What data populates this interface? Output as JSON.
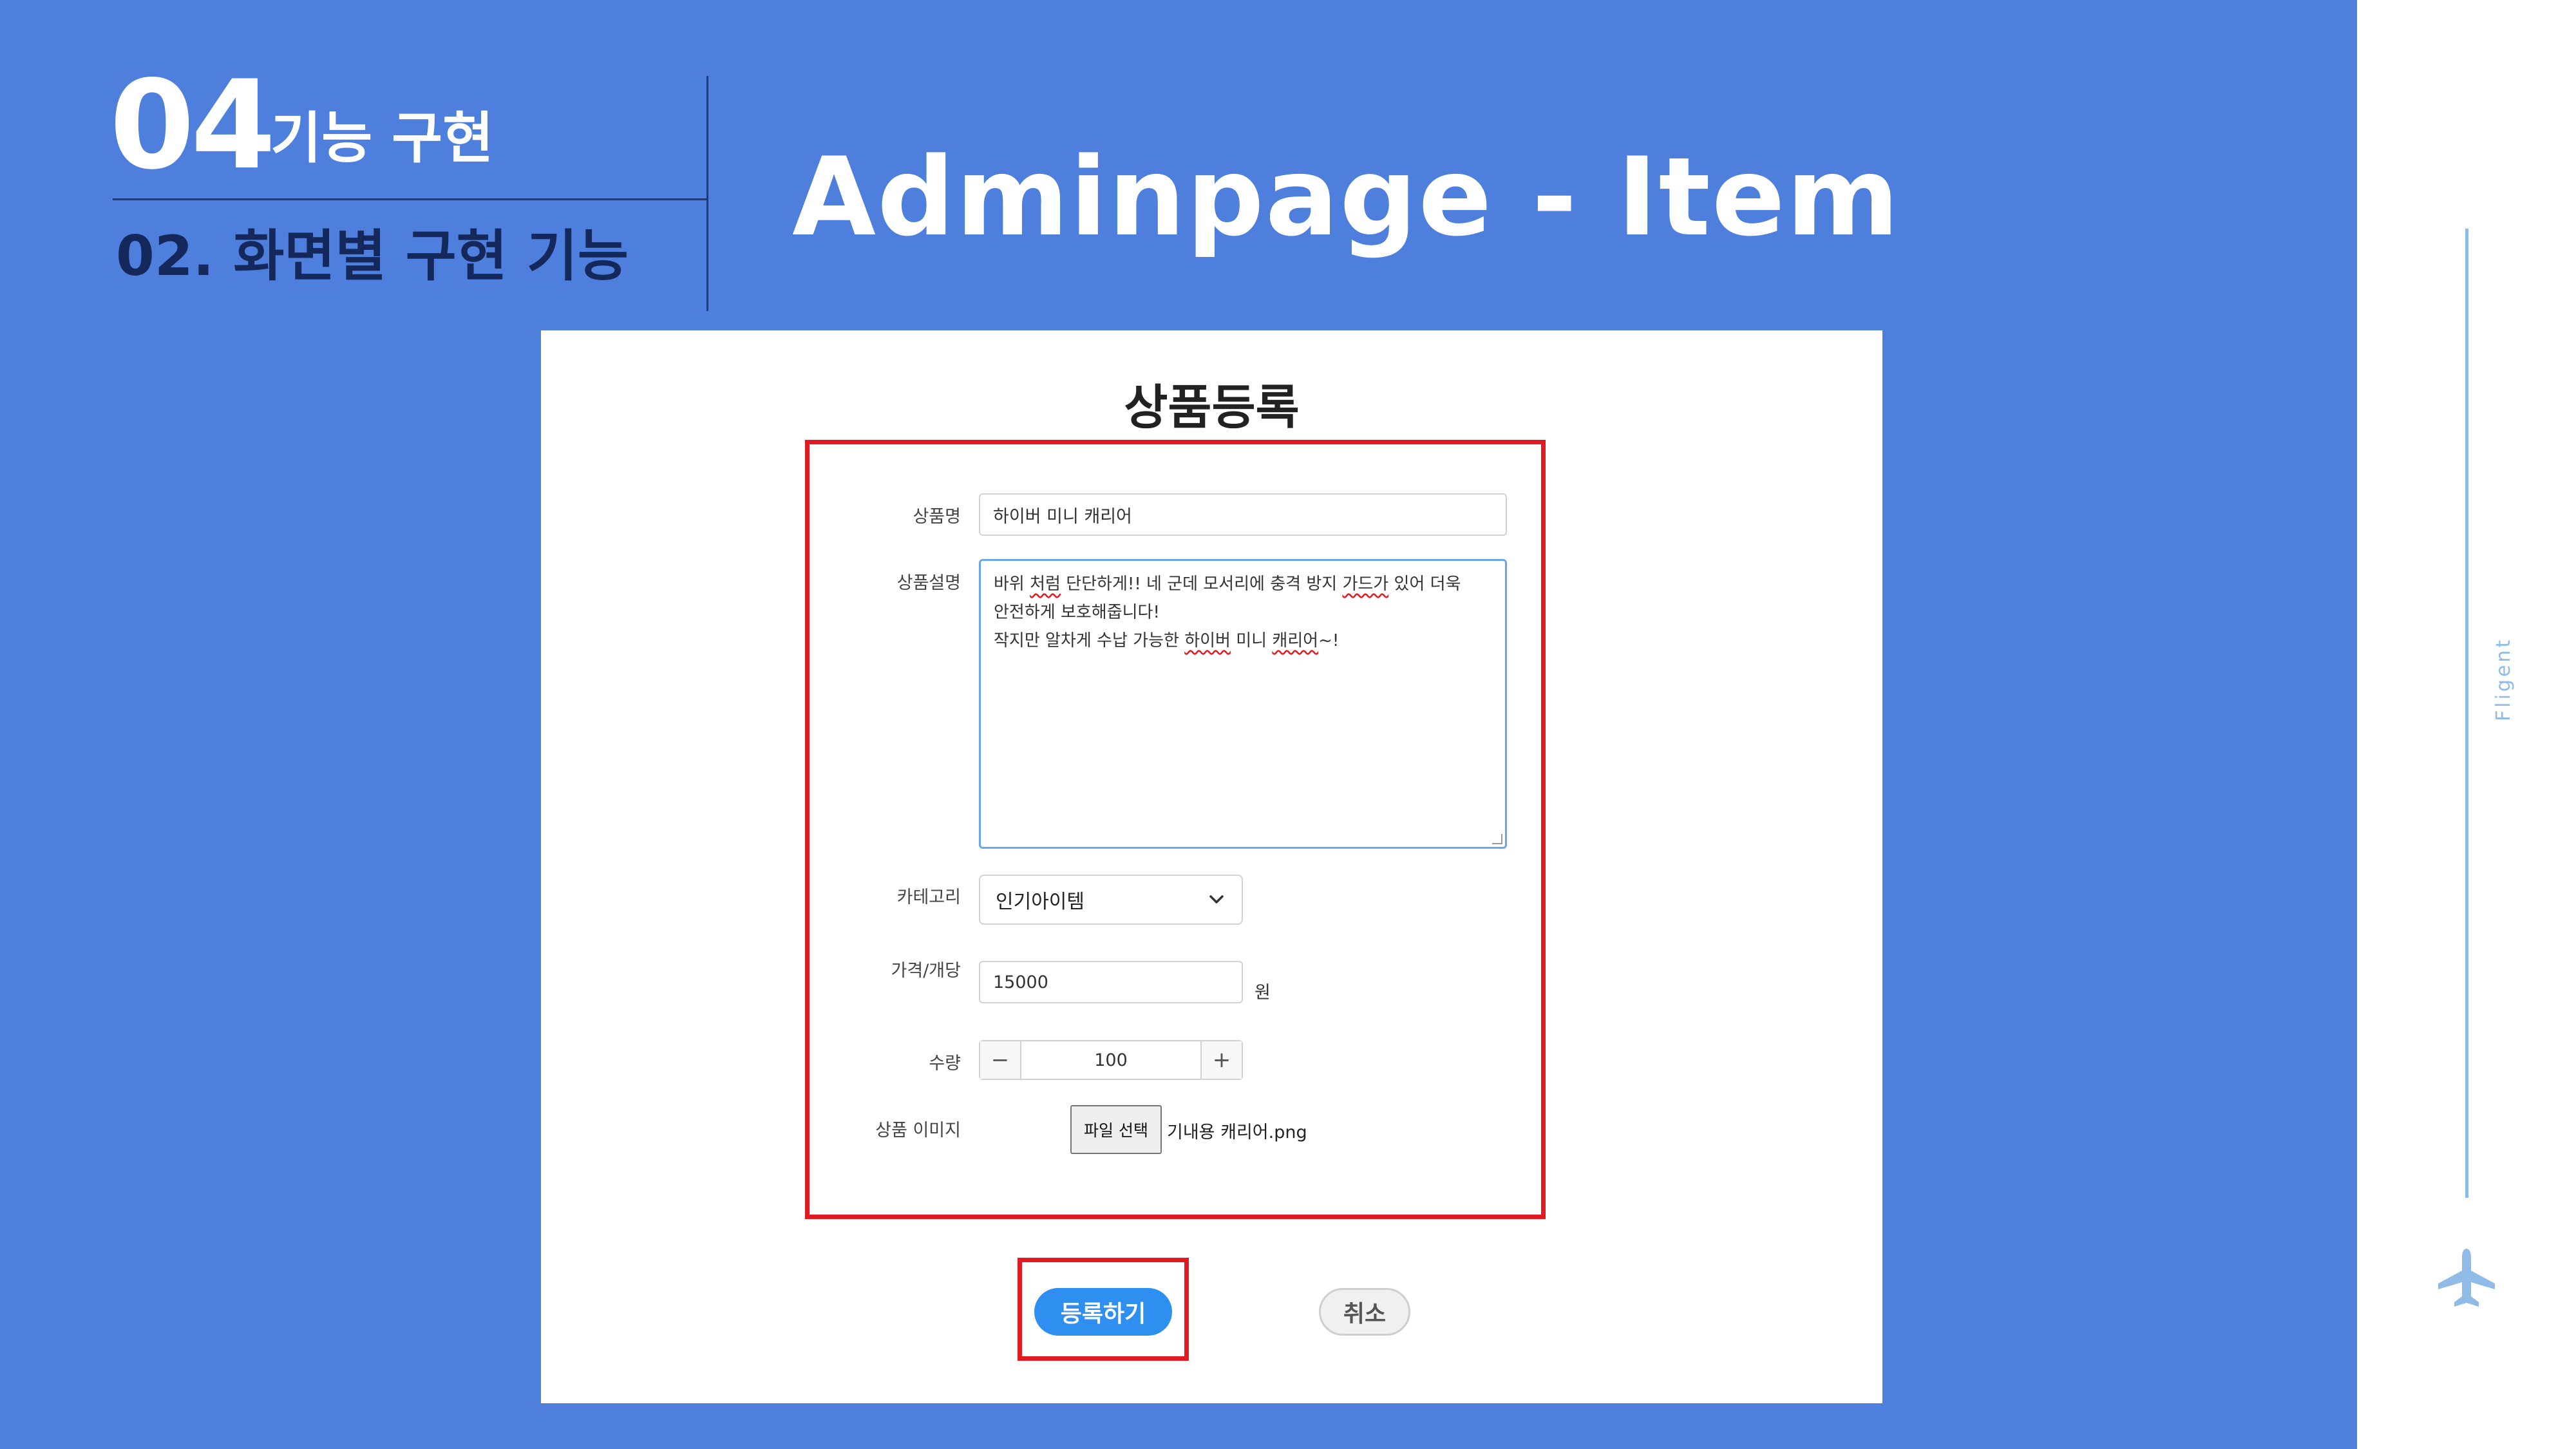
{
  "slide": {
    "section_number": "04",
    "section_title": "기능 구현",
    "subsection_title": "02. 화면별 구현 기능",
    "page_heading": "Adminpage - Item",
    "side_brand": "Fligent",
    "plane_icon": "airplane-icon"
  },
  "colors": {
    "slide_background": "#4f7fdd",
    "highlight": "#e11b22",
    "primary_button": "#2f8ff0",
    "side_accent": "#8fbbe6"
  },
  "form": {
    "title": "상품등록",
    "fields": {
      "name": {
        "label": "상품명",
        "value": "하이버 미니 캐리어"
      },
      "description": {
        "label": "상품설명",
        "line1_a": "바위 ",
        "line1_spell1": "처럼",
        "line1_b": " 단단하게!! 네 군데 모서리에 충격 방지 ",
        "line1_spell2": "가드가",
        "line1_c": " 있어 더욱",
        "line2": "안전하게 보호해줍니다!",
        "line3_a": "작지만 알차게 수납 가능한 ",
        "line3_spell1": "하이버",
        "line3_b": " 미니 ",
        "line3_spell2": "캐리어",
        "line3_c": "~!"
      },
      "category": {
        "label": "카테고리",
        "selected": "인기아이템",
        "chevron_icon": "chevron-down-icon"
      },
      "price": {
        "label": "가격/개당",
        "value": "15000",
        "unit": "원"
      },
      "quantity": {
        "label": "수량",
        "value": "100",
        "minus": "−",
        "plus": "+"
      },
      "image": {
        "label": "상품 이미지",
        "button": "파일 선택",
        "file_name": "기내용 캐리어.png"
      }
    },
    "actions": {
      "submit": "등록하기",
      "cancel": "취소"
    }
  }
}
